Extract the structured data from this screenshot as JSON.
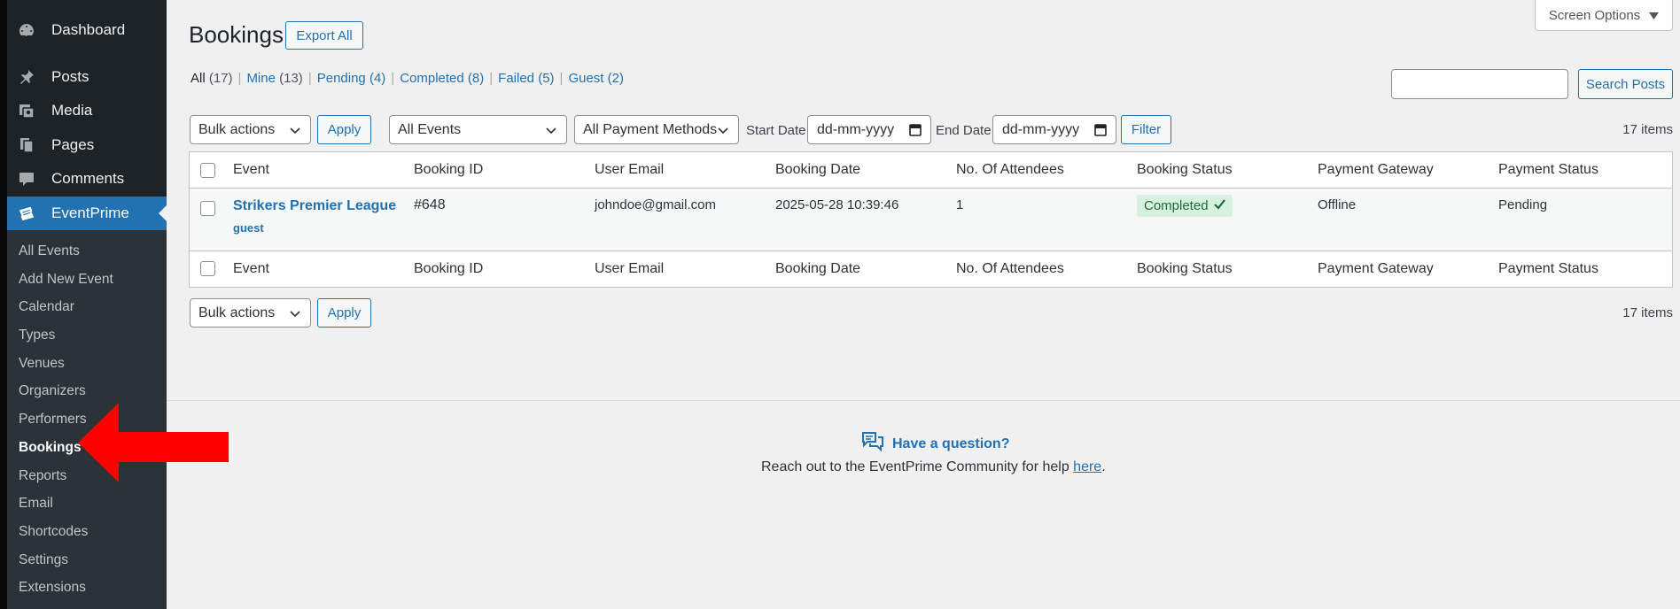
{
  "sidebar": {
    "top_items": [
      {
        "label": "Dashboard",
        "icon": "dashboard-icon"
      },
      {
        "label": "Posts",
        "icon": "pin-icon"
      },
      {
        "label": "Media",
        "icon": "media-icon"
      },
      {
        "label": "Pages",
        "icon": "pages-icon"
      },
      {
        "label": "Comments",
        "icon": "comment-icon"
      },
      {
        "label": "EventPrime",
        "icon": "ticket-icon"
      }
    ],
    "submenu": [
      "All Events",
      "Add New Event",
      "Calendar",
      "Types",
      "Venues",
      "Organizers",
      "Performers",
      "Bookings",
      "Reports",
      "Email",
      "Shortcodes",
      "Settings",
      "Extensions"
    ],
    "active_color": "#2271b1"
  },
  "header": {
    "title": "Bookings",
    "export_label": "Export All",
    "screen_options": "Screen Options"
  },
  "filters_links": [
    {
      "label": "All",
      "count": "(17)"
    },
    {
      "label": "Mine",
      "count": "(13)"
    },
    {
      "label": "Pending",
      "count": "(4)"
    },
    {
      "label": "Completed",
      "count": "(8)"
    },
    {
      "label": "Failed",
      "count": "(5)"
    },
    {
      "label": "Guest",
      "count": "(2)"
    }
  ],
  "search": {
    "button": "Search Posts",
    "value": ""
  },
  "toolbar": {
    "bulk_actions": "Bulk actions",
    "apply": "Apply",
    "events_select": "All Events",
    "payment_select": "All Payment Methods",
    "start_label": "Start Date",
    "end_label": "End Date",
    "date_placeholder": "dd-mm-yyyy",
    "filter": "Filter",
    "items": "17 items"
  },
  "table": {
    "columns": [
      "Event",
      "Booking ID",
      "User Email",
      "Booking Date",
      "No. Of Attendees",
      "Booking Status",
      "Payment Gateway",
      "Payment Status"
    ],
    "rows": [
      {
        "event": "Strikers Premier League",
        "user_type": "guest",
        "booking_id": "#648",
        "email": "johndoe@gmail.com",
        "date": "2025-05-28 10:39:46",
        "attendees": "1",
        "status": "Completed",
        "gateway": "Offline",
        "payment_status": "Pending"
      }
    ]
  },
  "help": {
    "title": "Have a question?",
    "text_before": "Reach out to the EventPrime Community for help ",
    "link": "here",
    "text_after": "."
  },
  "annotation": {
    "arrow_color": "#ff0000"
  }
}
